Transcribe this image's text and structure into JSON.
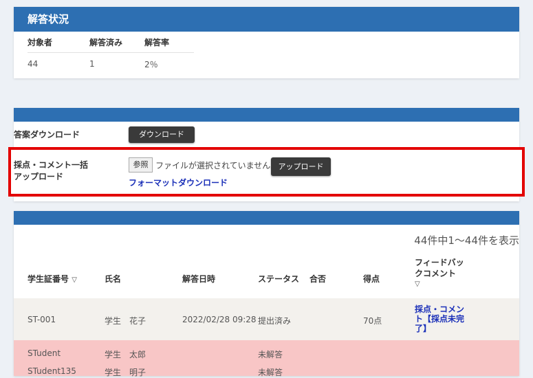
{
  "summary": {
    "title": "解答状況",
    "headers": [
      "対象者",
      "解答済み",
      "解答率"
    ],
    "values": [
      "44",
      "1",
      "2％"
    ]
  },
  "download": {
    "answer_label": "答案ダウンロード",
    "download_button": "ダウンロード",
    "upload_label_line1": "採点・コメント一括",
    "upload_label_line2": "アップロード",
    "browse_button": "参照",
    "no_file_text": "ファイルが選択されていません。",
    "upload_button": "アップロード",
    "format_link": "フォーマットダウンロード"
  },
  "list": {
    "count_text": "44件中1～44件を表示",
    "headers": {
      "student_id": "学生証番号",
      "sort_mark": "▽",
      "name": "氏名",
      "answered_at": "解答日時",
      "status": "ステータス",
      "pass": "合否",
      "score": "得点",
      "feedback_line1": "フィードバッ",
      "feedback_line2": "クコメント",
      "feedback_sort": "▽"
    },
    "rows": [
      {
        "student_id": "ST-001",
        "name": "学生　花子",
        "answered_at": "2022/02/28 09:28",
        "status": "提出済み",
        "score": "70点",
        "feedback_line1": "採点・コメン",
        "feedback_line2": "ト【採点未完",
        "feedback_line3": "了】"
      },
      {
        "student_id": "STudent",
        "name": "学生　太郎",
        "status": "未解答"
      },
      {
        "student_id": "STudent135",
        "name": "学生　明子",
        "status": "未解答"
      }
    ]
  },
  "colors": {
    "header_blue": "#2d6fb2",
    "highlight_red": "#e30000",
    "link_blue": "#1a2fb8",
    "unanswered_row": "#f8c6c6"
  }
}
